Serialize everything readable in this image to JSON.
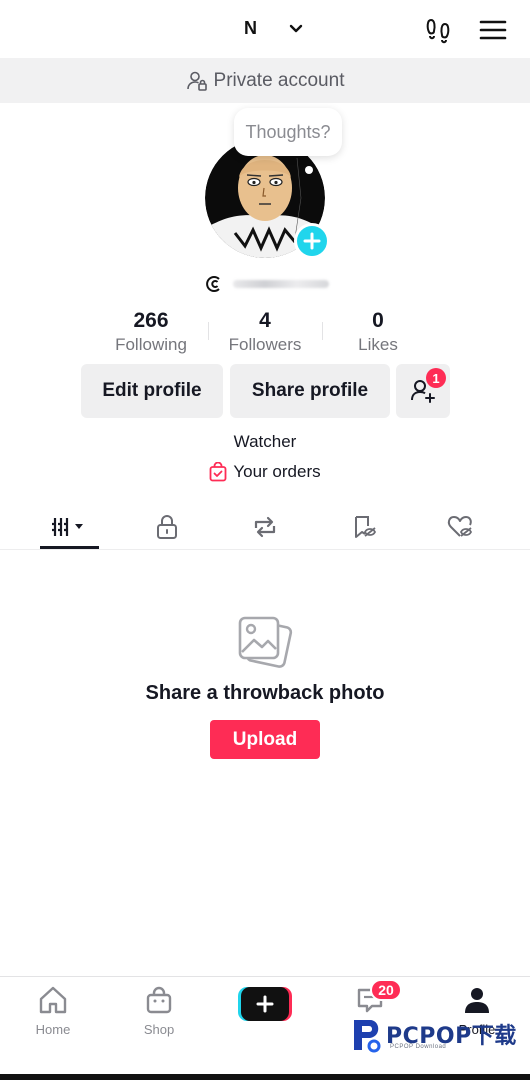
{
  "header": {
    "username": "N",
    "private_label": "Private account"
  },
  "profile": {
    "thoughts_prompt": "Thoughts?",
    "stats": [
      {
        "value": "266",
        "label": "Following"
      },
      {
        "value": "4",
        "label": "Followers"
      },
      {
        "value": "0",
        "label": "Likes"
      }
    ],
    "edit_label": "Edit profile",
    "share_label": "Share profile",
    "friend_requests_count": "1",
    "bio": "Watcher",
    "orders_label": "Your orders"
  },
  "tabs": [
    {
      "icon": "videos-grid-icon"
    },
    {
      "icon": "lock-icon"
    },
    {
      "icon": "repost-icon"
    },
    {
      "icon": "favorites-icon"
    },
    {
      "icon": "liked-icon"
    }
  ],
  "empty_state": {
    "title": "Share a throwback photo",
    "button": "Upload"
  },
  "bottom_nav": {
    "home": "Home",
    "shop": "Shop",
    "inbox_count": "20",
    "profile": "Profile"
  },
  "watermark": {
    "text": "PCPOP下载",
    "sub": "PCPOP Download"
  },
  "colors": {
    "accent": "#fe2c55",
    "teal": "#20d5ec",
    "text": "#161823"
  }
}
